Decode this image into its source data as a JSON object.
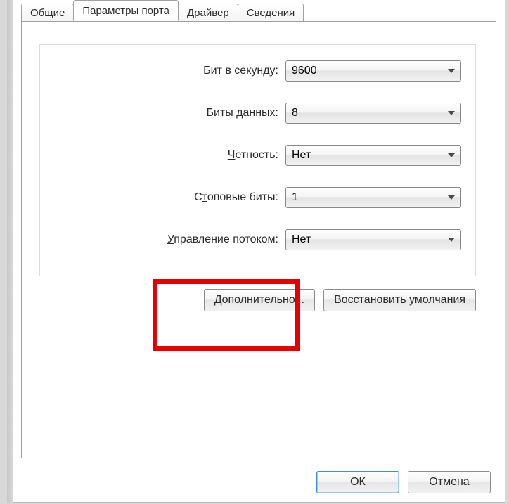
{
  "tabs": {
    "general": "Общие",
    "port_params": "Параметры порта",
    "driver": "Драйвер",
    "details": "Сведения"
  },
  "fields": {
    "baud": {
      "label_pre": "",
      "label_u": "Б",
      "label_post": "ит в секунду:",
      "value": "9600"
    },
    "databits": {
      "label_pre": "Б",
      "label_u": "и",
      "label_post": "ты данных:",
      "value": "8"
    },
    "parity": {
      "label_pre": "",
      "label_u": "Ч",
      "label_post": "етность:",
      "value": "Нет"
    },
    "stopbits": {
      "label_pre": "С",
      "label_u": "т",
      "label_post": "оповые биты:",
      "value": "1"
    },
    "flowctrl": {
      "label_pre": "",
      "label_u": "У",
      "label_post": "правление потоком:",
      "value": "Нет"
    }
  },
  "buttons": {
    "advanced_pre": "",
    "advanced_u": "Д",
    "advanced_post": "ополнительно...",
    "restore_pre": "",
    "restore_u": "В",
    "restore_post": "осстановить умолчания",
    "ok": "ОК",
    "cancel": "Отмена"
  }
}
